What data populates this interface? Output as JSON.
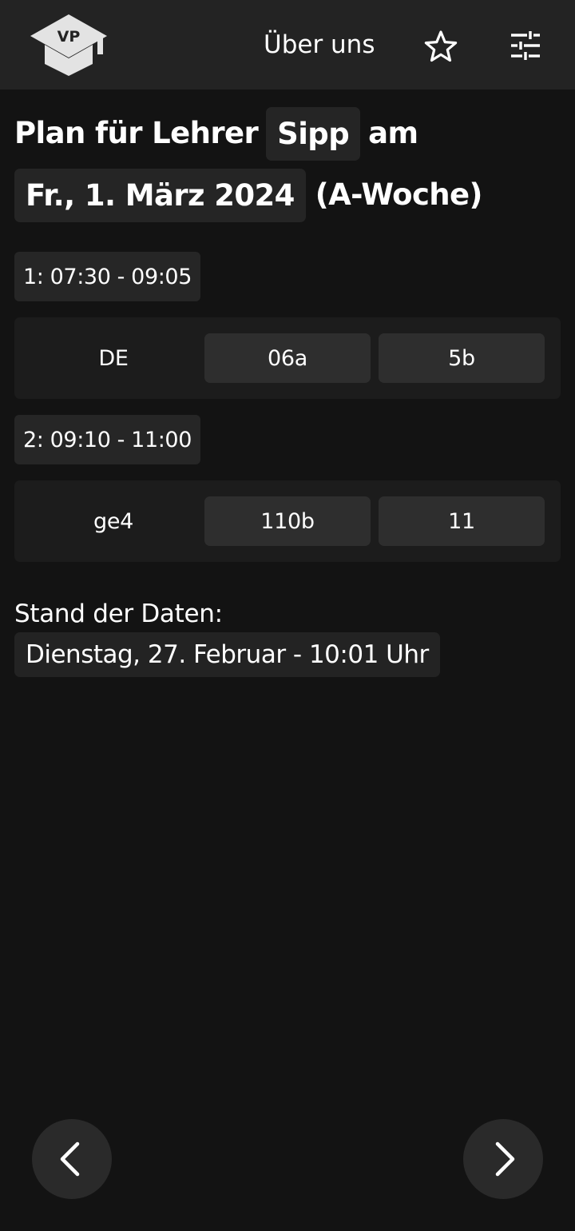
{
  "header": {
    "logo_text": "VP",
    "about_label": "Über uns",
    "favorite_icon": "star-icon",
    "settings_icon": "sliders-icon"
  },
  "title": {
    "prefix": "Plan für Lehrer",
    "teacher": "Sipp",
    "connector": "am",
    "date": "Fr., 1. März 2024",
    "week": "(A-Woche)"
  },
  "lessons": [
    {
      "period": "1: 07:30 - 09:05",
      "subject": "DE",
      "room": "06a",
      "group": "5b"
    },
    {
      "period": "2: 09:10 - 11:00",
      "subject": "ge4",
      "room": "110b",
      "group": "11"
    }
  ],
  "status": {
    "label": "Stand der Daten:",
    "value": "Dienstag, 27. Februar - 10:01 Uhr"
  },
  "navigation": {
    "prev_icon": "chevron-left-icon",
    "next_icon": "chevron-right-icon"
  },
  "colors": {
    "background": "#131313",
    "header": "#232323",
    "chip": "#262626",
    "row": "#1c1c1c",
    "cell_button": "#2e2e2e",
    "text": "#ffffff"
  }
}
